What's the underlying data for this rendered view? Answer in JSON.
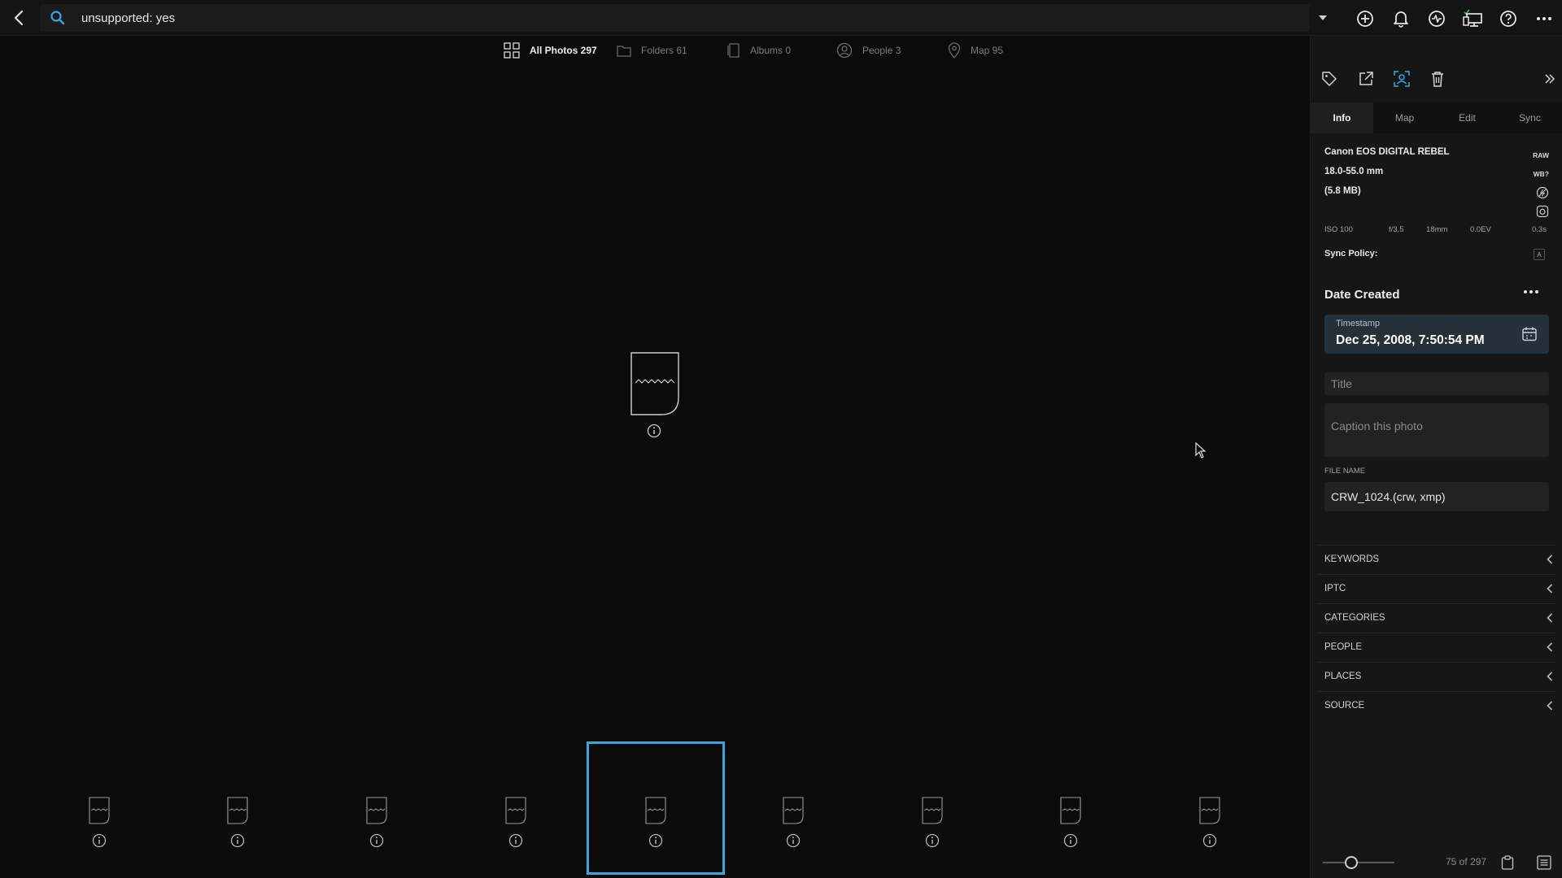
{
  "search": {
    "query": "unsupported: yes"
  },
  "view_tabs": [
    {
      "label": "All Photos 297",
      "icon": "grid-icon"
    },
    {
      "label": "Folders 61",
      "icon": "folder-icon"
    },
    {
      "label": "Albums 0",
      "icon": "album-icon"
    },
    {
      "label": "People 3",
      "icon": "person-icon"
    },
    {
      "label": "Map 95",
      "icon": "map-pin-icon"
    }
  ],
  "panel": {
    "tabs": [
      "Info",
      "Map",
      "Edit",
      "Sync"
    ],
    "camera": "Canon EOS DIGITAL REBEL",
    "lens": "18.0-55.0 mm",
    "size": "(5.8 MB)",
    "badges": {
      "raw": "RAW",
      "wb": "WB?"
    },
    "exif": {
      "iso": "ISO 100",
      "aperture": "f/3.5",
      "focal": "18mm",
      "ev": "0.0EV",
      "shutter": "0.3s"
    },
    "sync_policy_label": "Sync Policy:",
    "sync_policy_badge": "A",
    "date_title": "Date Created",
    "timestamp_label": "Timestamp",
    "timestamp_value": "Dec 25, 2008, 7:50:54 PM",
    "title_placeholder": "Title",
    "caption_placeholder": "Caption this photo",
    "file_name_label": "FILE NAME",
    "file_name": "CRW_1024.(crw, xmp)",
    "sections": [
      "KEYWORDS",
      "IPTC",
      "CATEGORIES",
      "PEOPLE",
      "PLACES",
      "SOURCE"
    ],
    "count": "75 of 297",
    "zoom_level": 0.4
  },
  "filmstrip": {
    "thumb_count": 9,
    "selected_index": 4
  },
  "colors": {
    "accent": "#3aa6df",
    "background": "#0b0b0b",
    "panel": "#161616"
  }
}
